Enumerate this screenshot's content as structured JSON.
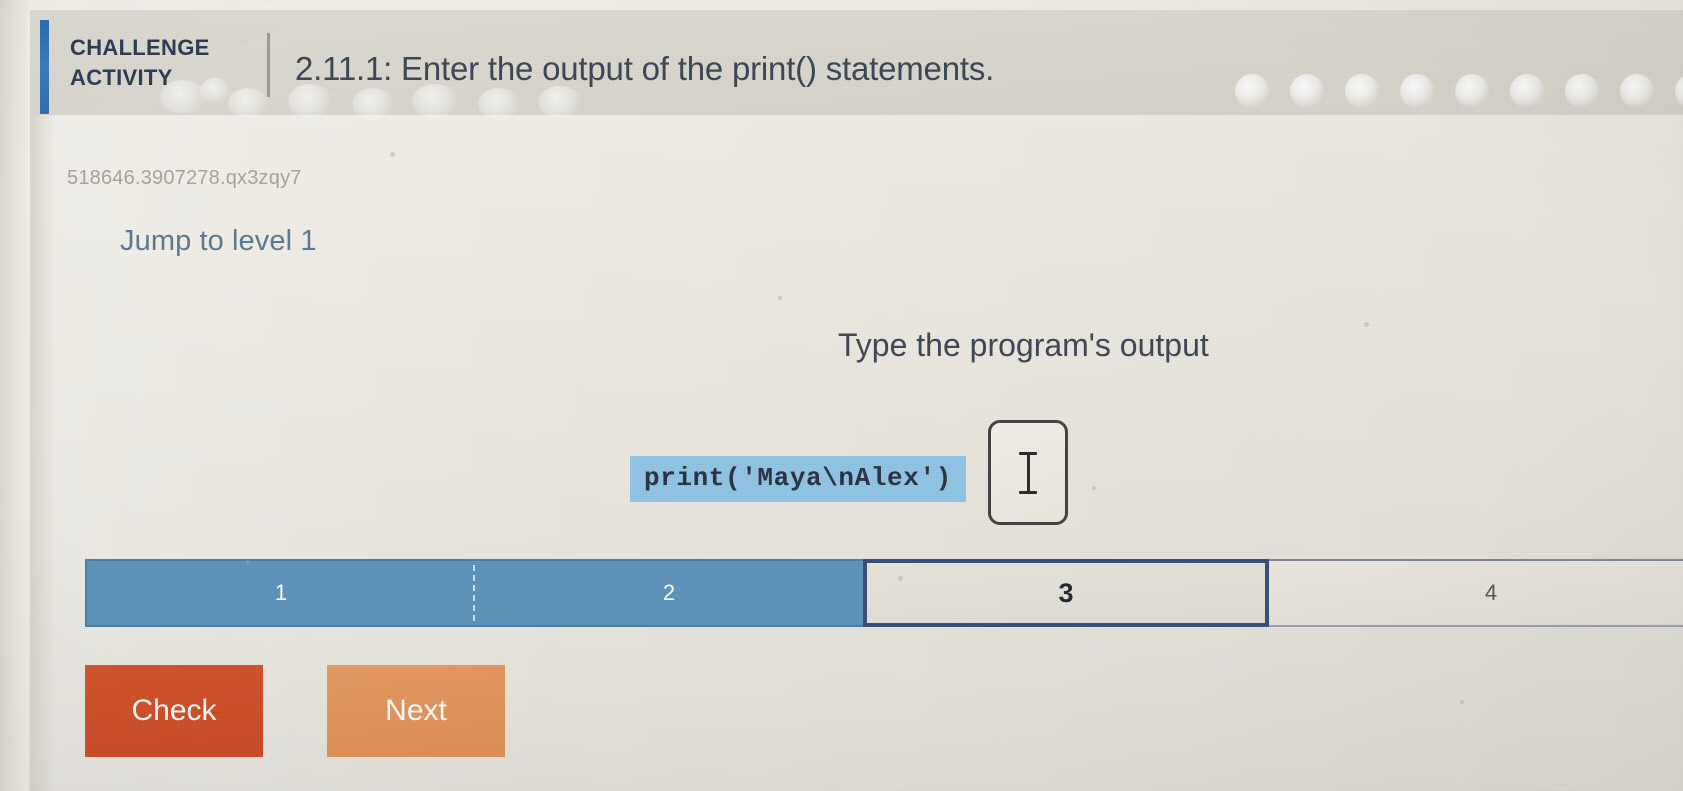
{
  "header": {
    "badge_line1": "CHALLENGE",
    "badge_line2": "ACTIVITY",
    "title": "2.11.1: Enter the output of the print() statements.",
    "accent_color": "#2f6fae",
    "background_color": "#d8d5cd"
  },
  "main": {
    "exercise_id": "518646.3907278.qx3zqy7",
    "jump_link": "Jump to level 1",
    "jump_link_color": "#5c7a95",
    "prompt_heading": "Type the program's output",
    "code_snippet": "print('Maya\\nAlex')",
    "code_highlight_color": "#90c4e4",
    "answer_input": {
      "value": "",
      "placeholder": "",
      "cursor": "text-cursor-ibeam"
    }
  },
  "progress": {
    "segments": [
      {
        "label": "1",
        "state": "done"
      },
      {
        "label": "2",
        "state": "done"
      },
      {
        "label": "3",
        "state": "active"
      },
      {
        "label": "4",
        "state": "todo"
      }
    ],
    "done_color": "#5e93ba",
    "active_border_color": "#3b4f77",
    "todo_color": "#e5e2da"
  },
  "actions": {
    "check_label": "Check",
    "check_color": "#d0502a",
    "next_label": "Next",
    "next_color": "#e2925a"
  }
}
